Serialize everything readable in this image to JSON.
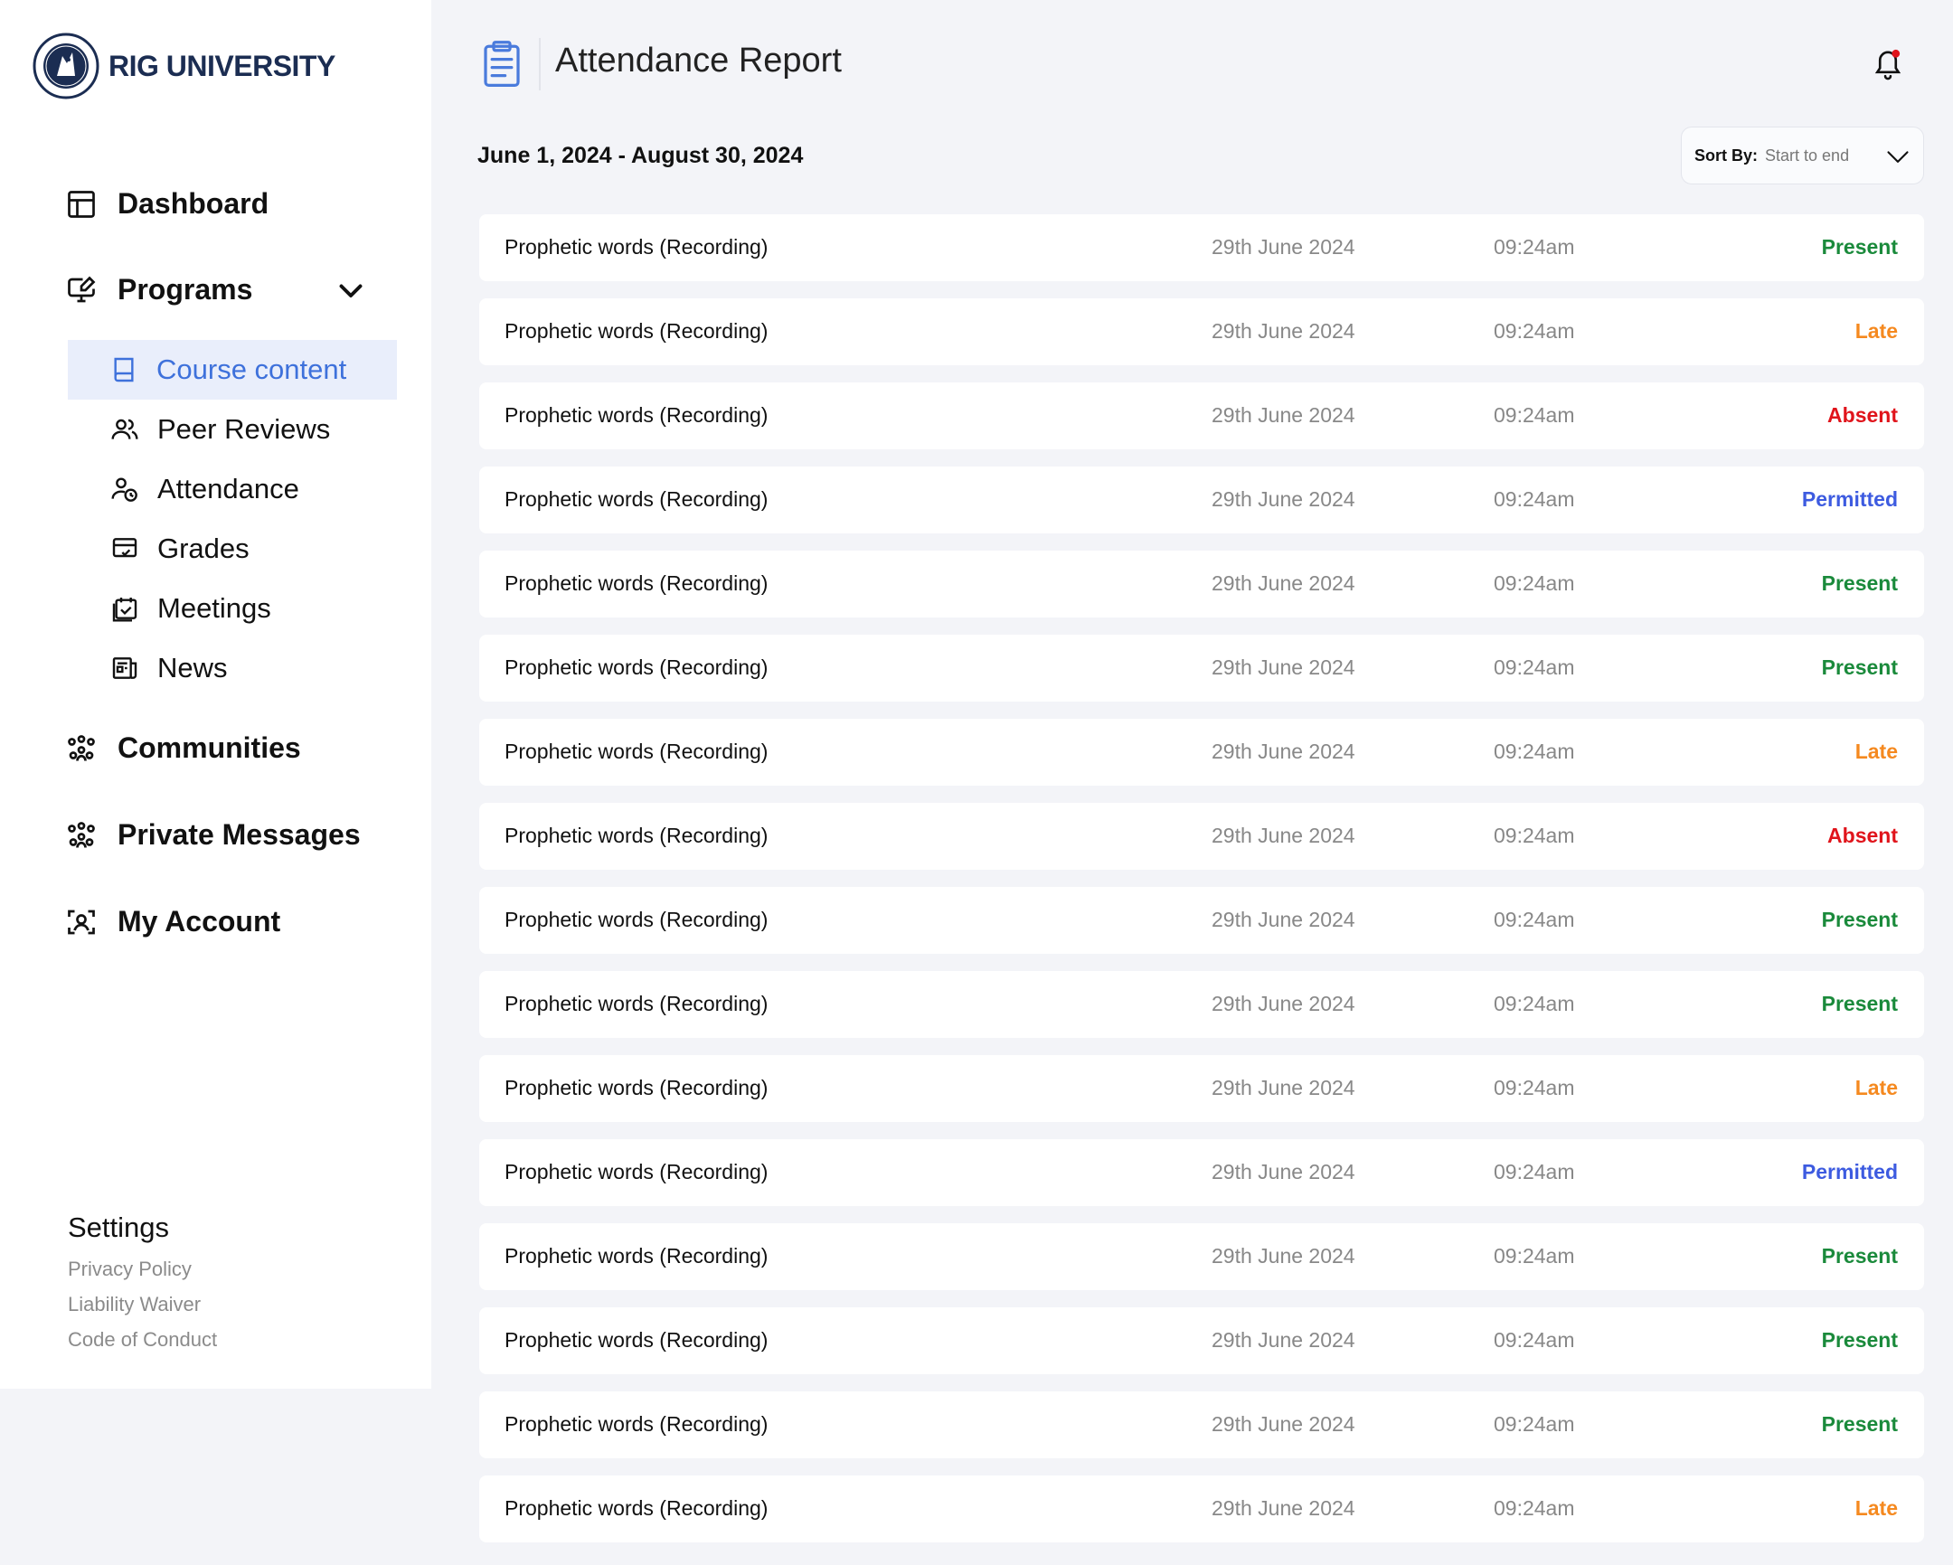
{
  "brand": {
    "name": "RIG UNIVERSITY"
  },
  "sidebar": {
    "dashboard": "Dashboard",
    "programs": "Programs",
    "programs_sub": [
      {
        "label": "Course content",
        "icon": "book-icon",
        "active": true
      },
      {
        "label": "Peer Reviews",
        "icon": "users-icon"
      },
      {
        "label": "Attendance",
        "icon": "user-clock-icon"
      },
      {
        "label": "Grades",
        "icon": "card-check-icon"
      },
      {
        "label": "Meetings",
        "icon": "calendar-check-icon"
      },
      {
        "label": "News",
        "icon": "newspaper-icon"
      }
    ],
    "communities": "Communities",
    "private_messages": "Private Messages",
    "my_account": "My Account",
    "settings": {
      "title": "Settings",
      "links": [
        "Privacy Policy",
        "Liability Waiver",
        "Code of Conduct"
      ]
    }
  },
  "header": {
    "title": "Attendance Report"
  },
  "filters": {
    "date_range": "June 1, 2024 - August 30, 2024",
    "sort_label": "Sort By:",
    "sort_value": "Start to end"
  },
  "status_colors": {
    "Present": "#1a8a3b",
    "Late": "#f5891f",
    "Absent": "#e0141b",
    "Permitted": "#3d5be0"
  },
  "records": [
    {
      "title": "Prophetic words (Recording)",
      "date": "29th June 2024",
      "time": "09:24am",
      "status": "Present"
    },
    {
      "title": "Prophetic words (Recording)",
      "date": "29th June 2024",
      "time": "09:24am",
      "status": "Late"
    },
    {
      "title": "Prophetic words (Recording)",
      "date": "29th June 2024",
      "time": "09:24am",
      "status": "Absent"
    },
    {
      "title": "Prophetic words (Recording)",
      "date": "29th June 2024",
      "time": "09:24am",
      "status": "Permitted"
    },
    {
      "title": "Prophetic words (Recording)",
      "date": "29th June 2024",
      "time": "09:24am",
      "status": "Present"
    },
    {
      "title": "Prophetic words (Recording)",
      "date": "29th June 2024",
      "time": "09:24am",
      "status": "Present"
    },
    {
      "title": "Prophetic words (Recording)",
      "date": "29th June 2024",
      "time": "09:24am",
      "status": "Late"
    },
    {
      "title": "Prophetic words (Recording)",
      "date": "29th June 2024",
      "time": "09:24am",
      "status": "Absent"
    },
    {
      "title": "Prophetic words (Recording)",
      "date": "29th June 2024",
      "time": "09:24am",
      "status": "Present"
    },
    {
      "title": "Prophetic words (Recording)",
      "date": "29th June 2024",
      "time": "09:24am",
      "status": "Present"
    },
    {
      "title": "Prophetic words (Recording)",
      "date": "29th June 2024",
      "time": "09:24am",
      "status": "Late"
    },
    {
      "title": "Prophetic words (Recording)",
      "date": "29th June 2024",
      "time": "09:24am",
      "status": "Permitted"
    },
    {
      "title": "Prophetic words (Recording)",
      "date": "29th June 2024",
      "time": "09:24am",
      "status": "Present"
    },
    {
      "title": "Prophetic words (Recording)",
      "date": "29th June 2024",
      "time": "09:24am",
      "status": "Present"
    },
    {
      "title": "Prophetic words (Recording)",
      "date": "29th June 2024",
      "time": "09:24am",
      "status": "Present"
    },
    {
      "title": "Prophetic words (Recording)",
      "date": "29th June 2024",
      "time": "09:24am",
      "status": "Late"
    }
  ]
}
